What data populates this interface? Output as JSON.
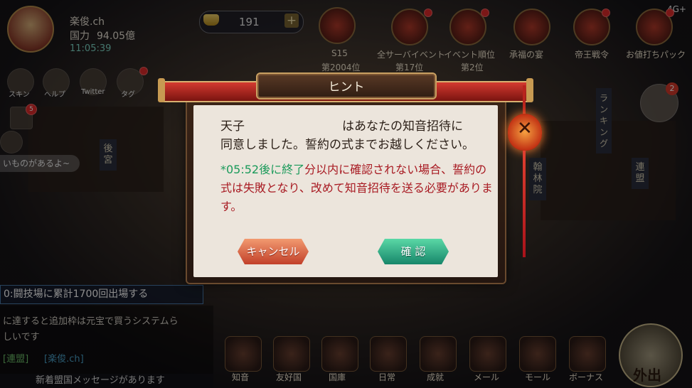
{
  "hud": {
    "player_name": "楽俊.ch",
    "power_label": "国力",
    "power_value": "94.05億",
    "time": "11:05:39",
    "gold": "191",
    "gold_plus": "+"
  },
  "status_bar": {
    "network": "4G+"
  },
  "top_menu": [
    {
      "label": "S15",
      "sub": "第2004位"
    },
    {
      "label": "全サーバイベント",
      "sub": "第17位"
    },
    {
      "label": "イベント順位",
      "sub": "第2位"
    },
    {
      "label": "承福の宴"
    },
    {
      "label": "帝王戦令"
    },
    {
      "label": "お値打ちパック"
    }
  ],
  "left_menu": [
    {
      "label": "スキン"
    },
    {
      "label": "ヘルプ"
    },
    {
      "label": "Twitter"
    },
    {
      "label": "タグ"
    }
  ],
  "left_badge": "5",
  "speech_bubble": "いものがあるよ~",
  "side_signs": {
    "kokyu": "後宮",
    "ranking": "ランキング",
    "hanrin": "翰林院",
    "renmei": "連盟"
  },
  "clover_badge": "2",
  "quest_text": "0:闘技場に累計1700回出場する",
  "chat": {
    "line1": "に達すると追加枠は元宝で買うシステムら",
    "line2": "しいです",
    "alliance_tag": "[連盟]",
    "user_tag": "[楽俊.ch]",
    "notice": "新着盟国メッセージがあります"
  },
  "bottom_menu": [
    "知音",
    "友好国",
    "国庫",
    "日常",
    "成就",
    "メール",
    "モール",
    "ボーナス"
  ],
  "go_out_label": "外出",
  "dialog": {
    "title": "ヒント",
    "line1_prefix": "天子",
    "line1_suffix": "はあなたの知音招待に",
    "line2": "同意しました。誓約の式までお越しください。",
    "warning_prefix": "*05:52後に終了",
    "warning_body": "分以内に確認されない場合、誓約の式は失敗となり、改めて知音招待を送る必要があります。",
    "cancel_label": "キャンセル",
    "confirm_label": "確 認",
    "close_icon": "close-x"
  },
  "colors": {
    "dialog_bg": "#ece5dc",
    "warning_red": "#a81a22",
    "timer_green": "#1a9a5a",
    "cancel_btn": "#d95a38",
    "confirm_btn": "#2aa882"
  }
}
